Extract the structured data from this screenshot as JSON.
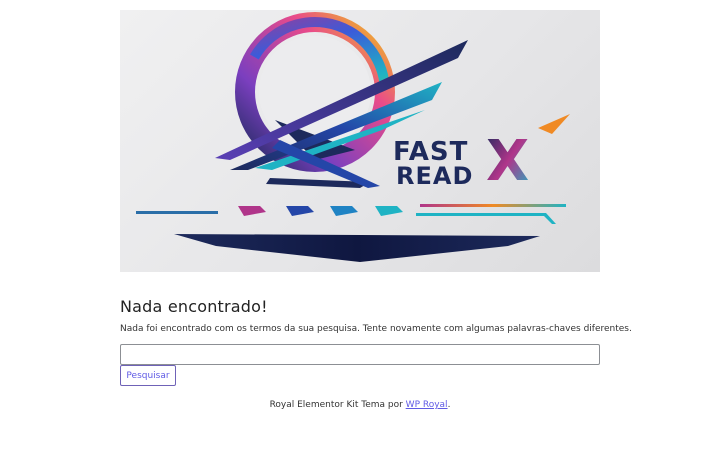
{
  "banner": {
    "logo_text_line1": "FAST",
    "logo_text_line2": "READ",
    "logo_text_x": "X",
    "alt": "FastReadX logo"
  },
  "content": {
    "heading": "Nada encontrado!",
    "message": "Nada foi encontrado com os termos da sua pesquisa. Tente novamente com algumas palavras-chaves diferentes.",
    "search_value": "",
    "search_placeholder": "",
    "search_button_label": "Pesquisar"
  },
  "footer": {
    "prefix": "Royal Elementor Kit Tema por ",
    "link_text": "WP Royal",
    "suffix": "."
  },
  "colors": {
    "link": "#605be5",
    "logo_navy": "#1d2a5c",
    "logo_teal": "#1fb3c4",
    "logo_magenta": "#b0358a",
    "logo_orange": "#f08a24"
  }
}
